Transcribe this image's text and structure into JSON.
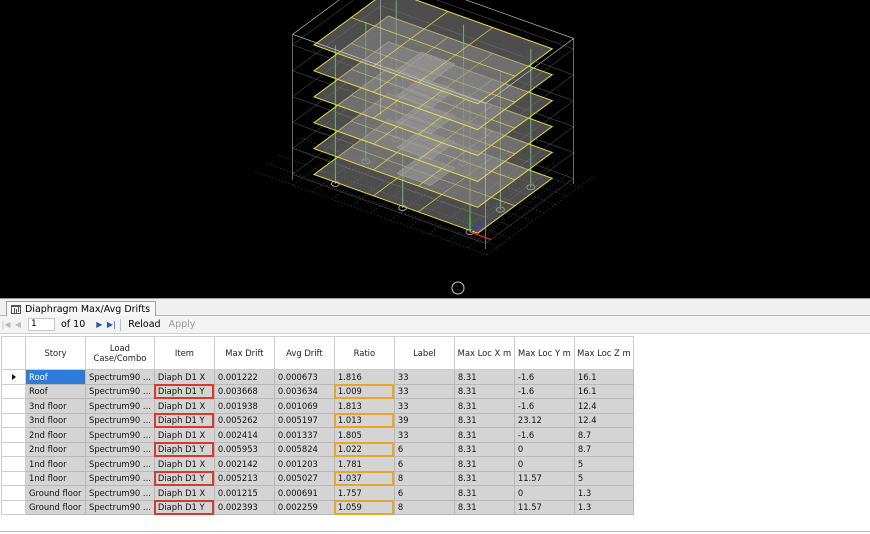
{
  "tab": {
    "label": "Diaphragm Max/Avg Drifts",
    "icon": "table-icon"
  },
  "navigator": {
    "first_icon": "first-page-icon",
    "prev_icon": "prev-page-icon",
    "page_value": "1",
    "of_pages": "of 10",
    "next_icon": "next-page-icon",
    "last_icon": "last-page-icon",
    "reload_label": "Reload",
    "apply_label": "Apply"
  },
  "table": {
    "columns": [
      {
        "key": "story",
        "label": "Story"
      },
      {
        "key": "load",
        "label": "Load Case/Combo"
      },
      {
        "key": "item",
        "label": "Item"
      },
      {
        "key": "max_drift",
        "label": "Max Drift"
      },
      {
        "key": "avg_drift",
        "label": "Avg Drift"
      },
      {
        "key": "ratio",
        "label": "Ratio"
      },
      {
        "key": "label",
        "label": "Label"
      },
      {
        "key": "max_loc_x",
        "label": "Max Loc X m"
      },
      {
        "key": "max_loc_y",
        "label": "Max Loc Y m"
      },
      {
        "key": "max_loc_z",
        "label": "Max Loc Z m"
      }
    ],
    "rows": [
      {
        "story": "Roof",
        "load": "Spectrum90 ...",
        "item": "Diaph D1 X",
        "max_drift": "0.001222",
        "avg_drift": "0.000673",
        "ratio": "1.816",
        "label": "33",
        "max_loc_x": "8.31",
        "max_loc_y": "-1.6",
        "max_loc_z": "16.1",
        "highlight": false,
        "selected": true
      },
      {
        "story": "Roof",
        "load": "Spectrum90 ...",
        "item": "Diaph D1 Y",
        "max_drift": "0.003668",
        "avg_drift": "0.003634",
        "ratio": "1.009",
        "label": "33",
        "max_loc_x": "8.31",
        "max_loc_y": "-1.6",
        "max_loc_z": "16.1",
        "highlight": true,
        "selected": false
      },
      {
        "story": "3nd floor",
        "load": "Spectrum90 ...",
        "item": "Diaph D1 X",
        "max_drift": "0.001938",
        "avg_drift": "0.001069",
        "ratio": "1.813",
        "label": "33",
        "max_loc_x": "8.31",
        "max_loc_y": "-1.6",
        "max_loc_z": "12.4",
        "highlight": false,
        "selected": false
      },
      {
        "story": "3nd floor",
        "load": "Spectrum90 ...",
        "item": "Diaph D1 Y",
        "max_drift": "0.005262",
        "avg_drift": "0.005197",
        "ratio": "1.013",
        "label": "39",
        "max_loc_x": "8.31",
        "max_loc_y": "23.12",
        "max_loc_z": "12.4",
        "highlight": true,
        "selected": false
      },
      {
        "story": "2nd floor",
        "load": "Spectrum90 ...",
        "item": "Diaph D1 X",
        "max_drift": "0.002414",
        "avg_drift": "0.001337",
        "ratio": "1.805",
        "label": "33",
        "max_loc_x": "8.31",
        "max_loc_y": "-1.6",
        "max_loc_z": "8.7",
        "highlight": false,
        "selected": false
      },
      {
        "story": "2nd floor",
        "load": "Spectrum90 ...",
        "item": "Diaph D1 Y",
        "max_drift": "0.005953",
        "avg_drift": "0.005824",
        "ratio": "1.022",
        "label": "6",
        "max_loc_x": "8.31",
        "max_loc_y": "0",
        "max_loc_z": "8.7",
        "highlight": true,
        "selected": false
      },
      {
        "story": "1nd floor",
        "load": "Spectrum90 ...",
        "item": "Diaph D1 X",
        "max_drift": "0.002142",
        "avg_drift": "0.001203",
        "ratio": "1.781",
        "label": "6",
        "max_loc_x": "8.31",
        "max_loc_y": "0",
        "max_loc_z": "5",
        "highlight": false,
        "selected": false
      },
      {
        "story": "1nd floor",
        "load": "Spectrum90 ...",
        "item": "Diaph D1 Y",
        "max_drift": "0.005213",
        "avg_drift": "0.005027",
        "ratio": "1.037",
        "label": "8",
        "max_loc_x": "8.31",
        "max_loc_y": "11.57",
        "max_loc_z": "5",
        "highlight": true,
        "selected": false
      },
      {
        "story": "Ground floor",
        "load": "Spectrum90 ...",
        "item": "Diaph D1 X",
        "max_drift": "0.001215",
        "avg_drift": "0.000691",
        "ratio": "1.757",
        "label": "6",
        "max_loc_x": "8.31",
        "max_loc_y": "0",
        "max_loc_z": "1.3",
        "highlight": false,
        "selected": false
      },
      {
        "story": "Ground floor",
        "load": "Spectrum90 ...",
        "item": "Diaph D1 Y",
        "max_drift": "0.002393",
        "avg_drift": "0.002259",
        "ratio": "1.059",
        "label": "8",
        "max_loc_x": "8.31",
        "max_loc_y": "11.57",
        "max_loc_z": "1.3",
        "highlight": true,
        "selected": false
      }
    ],
    "current_row_icon": "current-row-arrow-icon"
  },
  "colors": {
    "viewport_bg": "#000000",
    "slab": "#8c8c8c",
    "beam": "#e8d84a",
    "column": "#3fd43f",
    "wire": "#cfcfcf",
    "selection": "#2f7bd8",
    "item_highlight": "#d8392e",
    "ratio_highlight": "#e8a52c"
  }
}
